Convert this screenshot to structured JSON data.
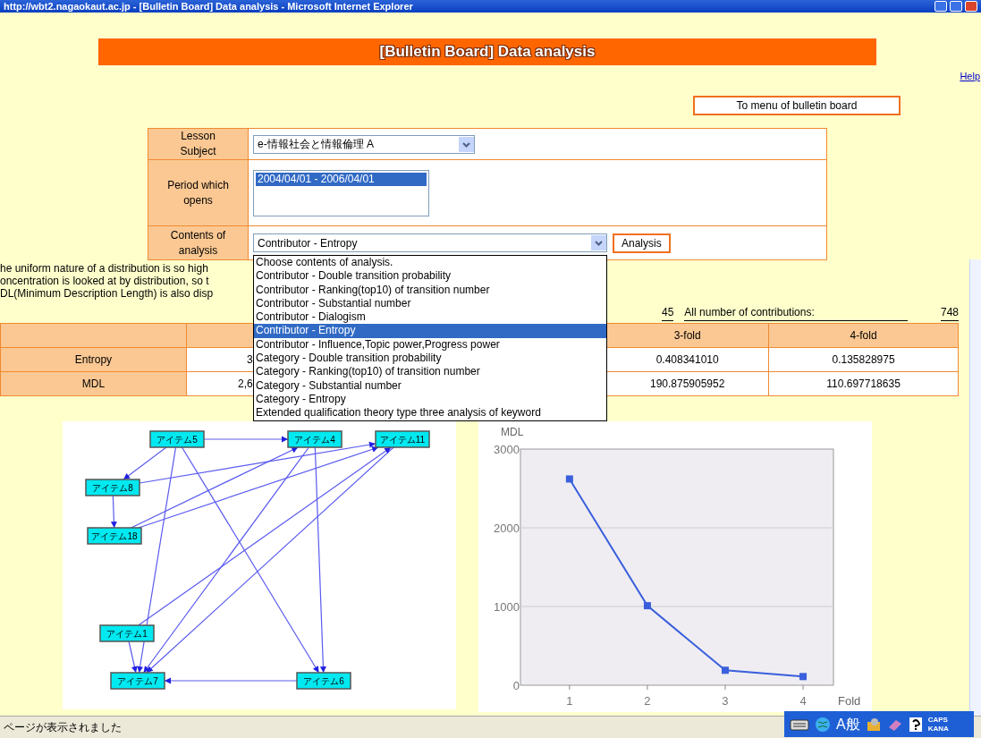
{
  "window": {
    "title": "http://wbt2.nagaokaut.ac.jp - [Bulletin Board] Data analysis - Microsoft Internet Explorer"
  },
  "banner": {
    "title": "[Bulletin Board] Data analysis"
  },
  "help_link": "Help",
  "menu_button": "To menu of bulletin board",
  "form": {
    "rows": [
      {
        "kind": "select",
        "label": "Lesson Subject",
        "value": "e-情報社会と情報倫理 A"
      },
      {
        "kind": "listbox",
        "label": "Period which opens",
        "options": [
          {
            "text": "2004/04/01 - 2006/04/01",
            "selected": true
          }
        ]
      },
      {
        "kind": "select",
        "label": "Contents of analysis",
        "value": "Contributor - Entropy",
        "button": "Analysis",
        "expanded": true
      }
    ]
  },
  "dropdown": {
    "options": [
      {
        "text": "Choose contents of analysis.",
        "selected": false
      },
      {
        "text": "Contributor - Double transition probability",
        "selected": false
      },
      {
        "text": "Contributor - Ranking(top10) of transition number",
        "selected": false
      },
      {
        "text": "Contributor - Substantial number",
        "selected": false
      },
      {
        "text": "Contributor - Dialogism",
        "selected": false
      },
      {
        "text": "Contributor - Entropy",
        "selected": true
      },
      {
        "text": "Contributor - Influence,Topic power,Progress power",
        "selected": false
      },
      {
        "text": "Category - Double transition probability",
        "selected": false
      },
      {
        "text": "Category - Ranking(top10) of transition number",
        "selected": false
      },
      {
        "text": "Category - Substantial number",
        "selected": false
      },
      {
        "text": "Category - Entropy",
        "selected": false
      },
      {
        "text": "Extended qualification theory type three analysis of keyword",
        "selected": false
      }
    ]
  },
  "description": [
    "he uniform nature of a distribution is so high",
    "oncentration is looked at by distribution, so t",
    "DL(Minimum Description Length) is also disp"
  ],
  "counts": {
    "value": "45",
    "label": "All number of contributions:",
    "total": "748"
  },
  "results": {
    "header": [
      "3-fold",
      "4-fold"
    ],
    "rows": [
      {
        "label": "Entropy",
        "column_2": "3",
        "fold_3": "0.408341010",
        "fold_4": "0.135828975"
      },
      {
        "label": "MDL",
        "column_2": "2,6",
        "fold_3": "190.875905952",
        "fold_4": "110.697718635"
      }
    ]
  },
  "graph": {
    "nodes": [
      "アイテム5",
      "アイテム4",
      "アイテム11",
      "アイテム8",
      "アイテム18",
      "アイテム1",
      "アイテム7",
      "アイテム6"
    ]
  },
  "chart": {
    "chart_data": {
      "type": "line",
      "xlabel": "Fold",
      "ylabel": "MDL",
      "x": [
        1,
        2,
        3,
        4
      ],
      "series": [
        {
          "color": "#3a5fdc",
          "marker": "square",
          "values": [
            2620,
            1010,
            190,
            110
          ]
        }
      ],
      "xlim": [
        0.37,
        4.39
      ],
      "xticks": [
        1,
        2,
        3,
        4
      ],
      "yticks": [
        0,
        1000,
        2000,
        3000
      ],
      "ylim": [
        0,
        3000
      ]
    }
  },
  "status_bar": {
    "text": "ページが表示されました"
  },
  "language_bar": {
    "mode": "A般",
    "caps": "CAPS",
    "kana": "KANA"
  }
}
